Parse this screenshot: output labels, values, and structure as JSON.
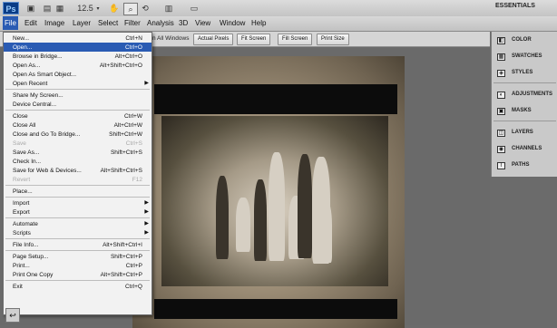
{
  "menubar": {
    "logo": "Ps",
    "items": [
      "File",
      "Edit",
      "Image",
      "Layer",
      "Select",
      "Filter",
      "Analysis",
      "3D",
      "View",
      "Window",
      "Help"
    ],
    "active": "File"
  },
  "toolbar": {
    "zoom": "12.5",
    "workspace": "ESSENTIALS"
  },
  "options_bar": {
    "partial_text": "n All Windows",
    "buttons": [
      "Actual Pixels",
      "Fit Screen",
      "Fill Screen",
      "Print Size"
    ]
  },
  "file_menu": {
    "items": [
      {
        "label": "New...",
        "shortcut": "Ctrl+N"
      },
      {
        "label": "Open...",
        "shortcut": "Ctrl+O",
        "highlighted": true
      },
      {
        "label": "Browse in Bridge...",
        "shortcut": "Alt+Ctrl+O"
      },
      {
        "label": "Open As...",
        "shortcut": "Alt+Shift+Ctrl+O"
      },
      {
        "label": "Open As Smart Object...",
        "shortcut": ""
      },
      {
        "label": "Open Recent",
        "shortcut": "",
        "submenu": true
      },
      {
        "separator": true
      },
      {
        "label": "Share My Screen...",
        "shortcut": ""
      },
      {
        "label": "Device Central...",
        "shortcut": ""
      },
      {
        "separator": true
      },
      {
        "label": "Close",
        "shortcut": "Ctrl+W"
      },
      {
        "label": "Close All",
        "shortcut": "Alt+Ctrl+W"
      },
      {
        "label": "Close and Go To Bridge...",
        "shortcut": "Shift+Ctrl+W"
      },
      {
        "label": "Save",
        "shortcut": "Ctrl+S",
        "disabled": true
      },
      {
        "label": "Save As...",
        "shortcut": "Shift+Ctrl+S"
      },
      {
        "label": "Check In...",
        "shortcut": ""
      },
      {
        "label": "Save for Web & Devices...",
        "shortcut": "Alt+Shift+Ctrl+S"
      },
      {
        "label": "Revert",
        "shortcut": "F12",
        "disabled": true
      },
      {
        "separator": true
      },
      {
        "label": "Place...",
        "shortcut": ""
      },
      {
        "separator": true
      },
      {
        "label": "Import",
        "shortcut": "",
        "submenu": true
      },
      {
        "label": "Export",
        "shortcut": "",
        "submenu": true
      },
      {
        "separator": true
      },
      {
        "label": "Automate",
        "shortcut": "",
        "submenu": true
      },
      {
        "label": "Scripts",
        "shortcut": "",
        "submenu": true
      },
      {
        "separator": true
      },
      {
        "label": "File Info...",
        "shortcut": "Alt+Shift+Ctrl+I"
      },
      {
        "separator": true
      },
      {
        "label": "Page Setup...",
        "shortcut": "Shift+Ctrl+P"
      },
      {
        "label": "Print...",
        "shortcut": "Ctrl+P"
      },
      {
        "label": "Print One Copy",
        "shortcut": "Alt+Shift+Ctrl+P"
      },
      {
        "separator": true
      },
      {
        "label": "Exit",
        "shortcut": "Ctrl+Q"
      }
    ]
  },
  "panels": {
    "groups": [
      [
        {
          "label": "COLOR",
          "icon": "color-icon"
        },
        {
          "label": "SWATCHES",
          "icon": "swatches-icon"
        },
        {
          "label": "STYLES",
          "icon": "styles-icon"
        }
      ],
      [
        {
          "label": "ADJUSTMENTS",
          "icon": "adjustments-icon"
        },
        {
          "label": "MASKS",
          "icon": "masks-icon"
        }
      ],
      [
        {
          "label": "LAYERS",
          "icon": "layers-icon"
        },
        {
          "label": "CHANNELS",
          "icon": "channels-icon"
        },
        {
          "label": "PATHS",
          "icon": "paths-icon"
        }
      ]
    ]
  },
  "colors": {
    "highlight": "#2a5bb3",
    "menu_bg": "#f2f2f2",
    "canvas_bg": "#6a6a6a"
  }
}
